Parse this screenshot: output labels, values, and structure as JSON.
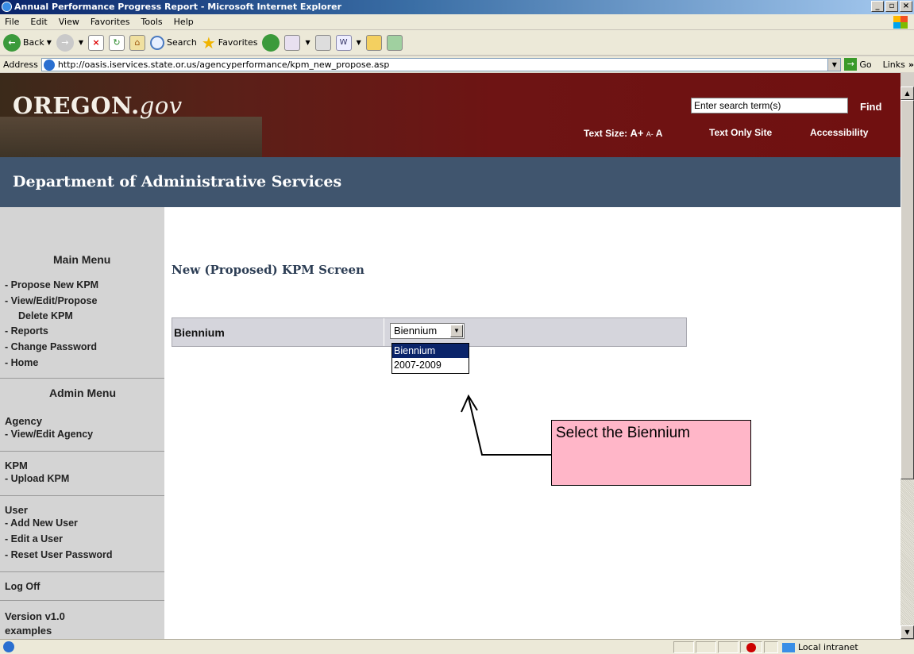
{
  "window": {
    "title": "Annual Performance Progress Report - Microsoft Internet Explorer",
    "buttons": [
      "_",
      "▫",
      "×"
    ]
  },
  "menubar": [
    "File",
    "Edit",
    "View",
    "Favorites",
    "Tools",
    "Help"
  ],
  "toolbar": {
    "back": "Back",
    "search": "Search",
    "favorites": "Favorites"
  },
  "address": {
    "label": "Address",
    "url": "http://oasis.iservices.state.or.us/agencyperformance/kpm_new_propose.asp",
    "go": "Go",
    "links": "Links"
  },
  "banner": {
    "logo_main": "OREGON.",
    "logo_suffix": "gov",
    "search_placeholder": "Enter search term(s)",
    "find": "Find",
    "text_size_label": "Text Size:",
    "text_size_big": "A+",
    "text_size_small": "A-",
    "text_size_normal": "A",
    "text_only": "Text Only Site",
    "accessibility": "Accessibility"
  },
  "department": "Department of Administrative Services",
  "sidebar": {
    "main_menu": "Main Menu",
    "main_items": [
      "- Propose New KPM",
      "- View/Edit/Propose",
      "Delete KPM",
      "- Reports",
      "- Change Password",
      "- Home"
    ],
    "admin_menu": "Admin Menu",
    "agency": "Agency",
    "agency_item": "- View/Edit Agency",
    "kpm": "KPM",
    "kpm_item": "- Upload KPM",
    "user": "User",
    "user_items": [
      "- Add New User",
      "- Edit a User",
      "- Reset User Password"
    ],
    "logoff": "Log Off",
    "version": "Version v1.0",
    "examples": "examples"
  },
  "content": {
    "title": "New (Proposed) KPM Screen",
    "biennium_label": "Biennium",
    "select_value": "Biennium",
    "options": [
      "Biennium",
      "2007-2009"
    ],
    "callout": "Select the Biennium"
  },
  "status": {
    "zone": "Local intranet"
  },
  "colors": {
    "banner": "#6e1414",
    "dept_bar": "#40556e",
    "callout": "#ffb6c8",
    "sidebar": "#d4d4d4",
    "title_text": "#2d3e55"
  }
}
